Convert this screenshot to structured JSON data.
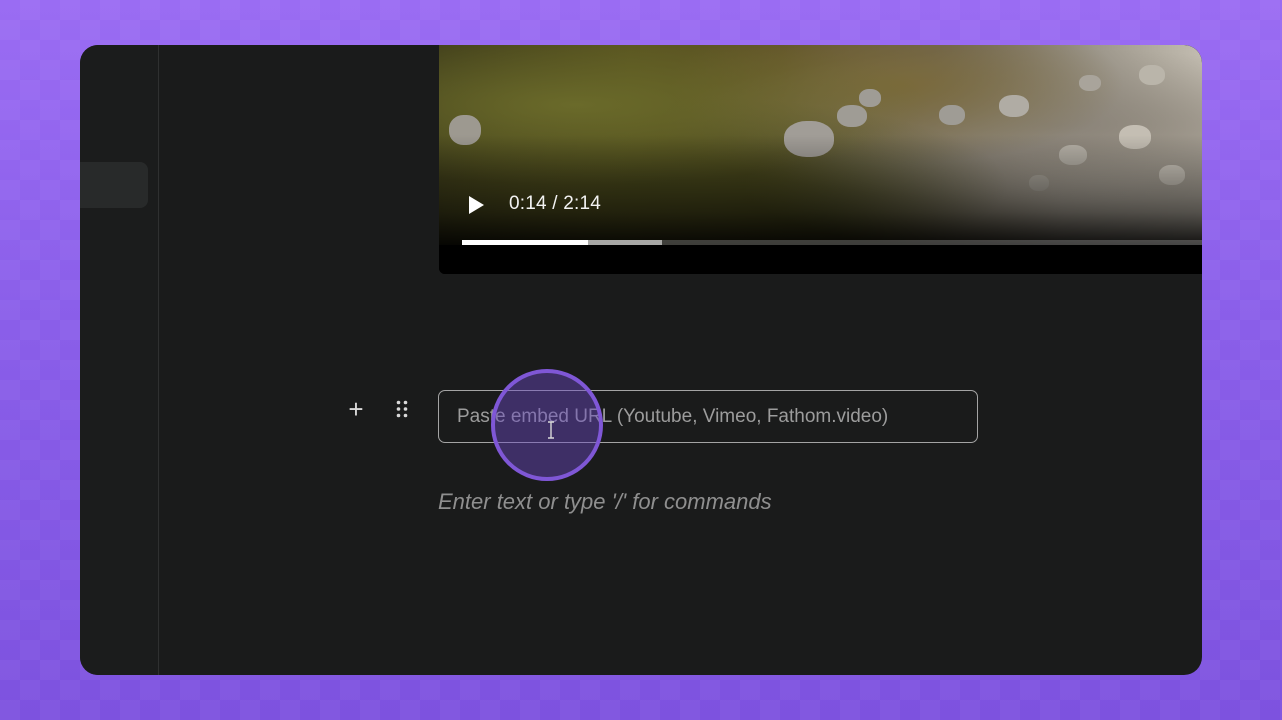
{
  "video": {
    "time_display": "0:14 / 2:14",
    "played_fraction": 0.17,
    "buffered_fraction": 0.27,
    "play_icon": "play-icon"
  },
  "editor": {
    "add_icon": "plus-icon",
    "add_symbol": "+",
    "drag_icon": "drag-handle-icon",
    "embed_input": {
      "placeholder": "Paste embed URL (Youtube, Vimeo, Fathom.video)",
      "value": ""
    },
    "placeholder_text": "Enter text or type '/' for commands"
  },
  "colors": {
    "background": "#8b5ee9",
    "window": "#1a1b1b",
    "cursor_highlight": "#7f57d6"
  }
}
